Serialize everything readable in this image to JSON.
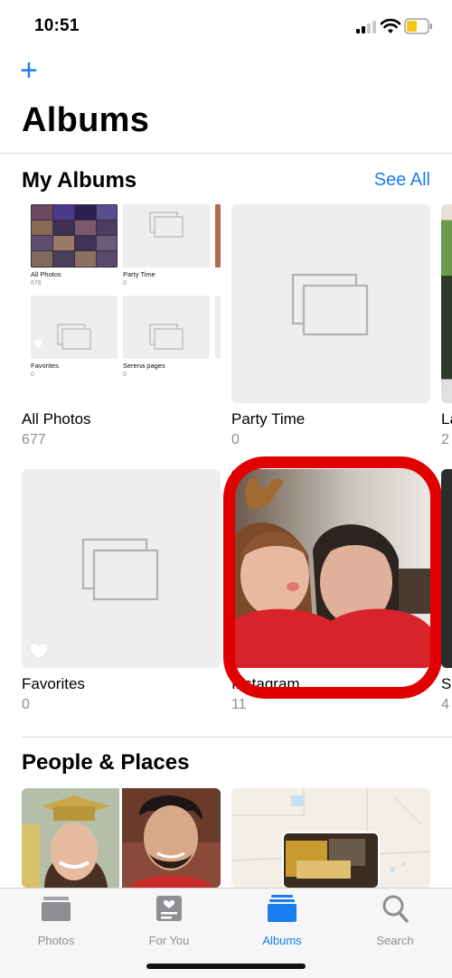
{
  "status_bar": {
    "time": "10:51"
  },
  "header": {
    "add_label": "+",
    "title": "Albums"
  },
  "my_albums": {
    "title": "My Albums",
    "see_all": "See All",
    "mini_albums": [
      {
        "name": "All Photos",
        "count": "676"
      },
      {
        "name": "Party Time",
        "count": "0"
      },
      {
        "name": "Favorites",
        "count": "0"
      },
      {
        "name": "Serena pages",
        "count": "0"
      }
    ],
    "albums": [
      {
        "name": "All Photos",
        "count": "677"
      },
      {
        "name": "Party Time",
        "count": "0"
      },
      {
        "name": "La",
        "count": "2"
      },
      {
        "name": "Favorites",
        "count": "0"
      },
      {
        "name": "Instagram",
        "count": "11"
      },
      {
        "name": "S",
        "count": "4"
      }
    ]
  },
  "people_places": {
    "title": "People & Places"
  },
  "tab_bar": {
    "tabs": [
      {
        "label": "Photos",
        "icon": "photos-icon"
      },
      {
        "label": "For You",
        "icon": "for-you-icon"
      },
      {
        "label": "Albums",
        "icon": "albums-icon"
      },
      {
        "label": "Search",
        "icon": "search-icon"
      }
    ],
    "active": "Albums"
  },
  "colors": {
    "accent": "#1a7ef0",
    "highlight_ring": "#e00000",
    "placeholder": "#eeeeef"
  }
}
